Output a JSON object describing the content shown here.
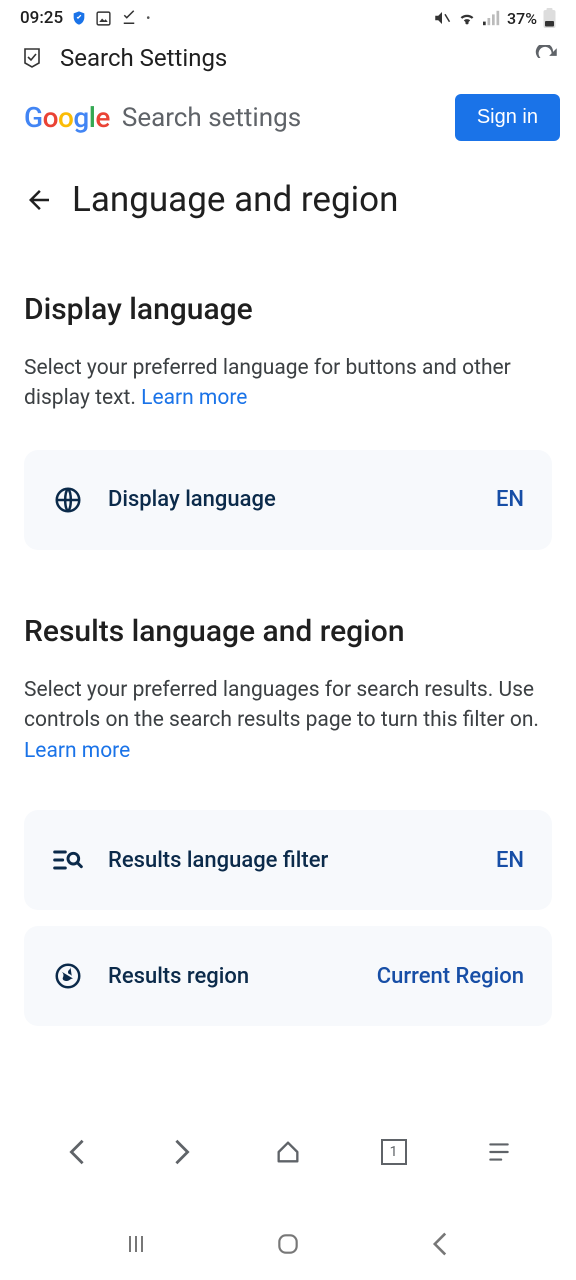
{
  "status": {
    "time": "09:25",
    "battery": "37%"
  },
  "appBar": {
    "title": "Search Settings"
  },
  "header": {
    "title": "Search settings",
    "signin": "Sign in"
  },
  "page": {
    "title": "Language and region"
  },
  "section1": {
    "title": "Display language",
    "desc": "Select your preferred language for buttons and other display text. ",
    "learn": "Learn more",
    "card_label": "Display language",
    "card_value": "EN"
  },
  "section2": {
    "title": "Results language and region",
    "desc": "Select your preferred languages for search results. Use controls on the search results page to turn this filter on.",
    "learn": "Learn more",
    "card1_label": "Results language filter",
    "card1_value": "EN",
    "card2_label": "Results region",
    "card2_value": "Current Region"
  },
  "browserBar": {
    "tabs": "1"
  }
}
